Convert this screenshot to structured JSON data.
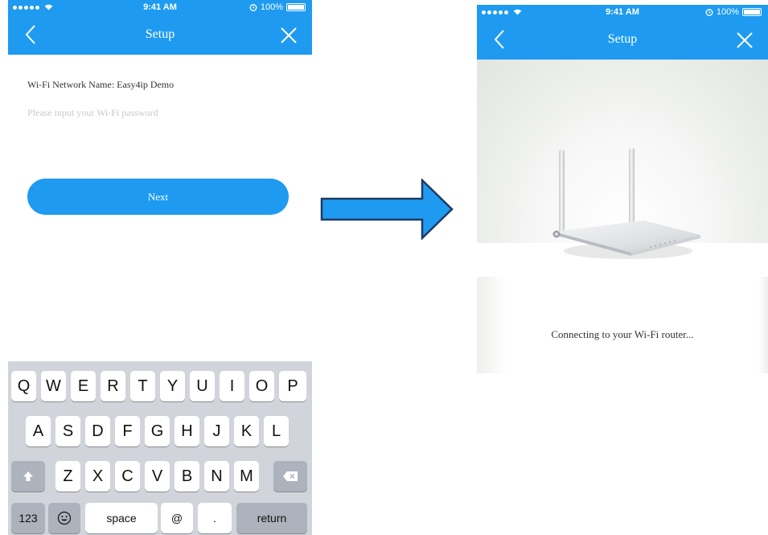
{
  "status_bar": {
    "time": "9:41 AM",
    "battery": "100%"
  },
  "left_screen": {
    "nav_title": "Setup",
    "network_label": "Wi-Fi Network Name: Easy4ip Demo",
    "password_placeholder": "Please input your Wi-Fi password",
    "password_value": "",
    "next_label": "Next"
  },
  "keyboard": {
    "row1": [
      "Q",
      "W",
      "E",
      "R",
      "T",
      "Y",
      "U",
      "I",
      "O",
      "P"
    ],
    "row2": [
      "A",
      "S",
      "D",
      "F",
      "G",
      "H",
      "J",
      "K",
      "L"
    ],
    "row3": [
      "Z",
      "X",
      "C",
      "V",
      "B",
      "N",
      "M"
    ],
    "numbers_key": "123",
    "space_key": "space",
    "at_key": "@",
    "period_key": ".",
    "return_key": "return"
  },
  "right_screen": {
    "nav_title": "Setup",
    "connecting_text": "Connecting to your Wi-Fi router..."
  },
  "colors": {
    "accent": "#1e9bf0",
    "arrow_fill": "#1e9bf0",
    "arrow_stroke": "#1f3b63",
    "keyboard_bg": "#d1d5db"
  },
  "icons": [
    "back-chevron-icon",
    "close-icon",
    "wifi-icon",
    "alarm-icon",
    "battery-icon",
    "shift-icon",
    "delete-icon",
    "emoji-icon",
    "flow-arrow-icon"
  ]
}
